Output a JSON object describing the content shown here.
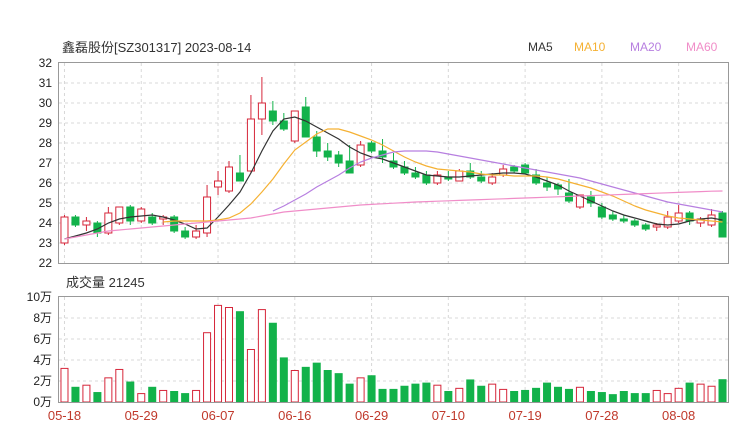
{
  "header": {
    "title": "鑫磊股份[SZ301317] 2023-08-14",
    "volume_title": "成交量 21245"
  },
  "colors": {
    "up": "#d6263a",
    "down": "#12b24a",
    "ma5": "#333333",
    "ma10": "#f5b133",
    "ma20": "#b77fe0",
    "ma60": "#f08dc8"
  },
  "chart_data": [
    {
      "type": "candlestick",
      "title": "鑫磊股份[SZ301317] 2023-08-14",
      "ylim": [
        22,
        32
      ],
      "yticks": [
        "22",
        "23",
        "24",
        "25",
        "26",
        "27",
        "28",
        "29",
        "30",
        "31",
        "32"
      ],
      "grid": true,
      "legend": [
        "MA5",
        "MA10",
        "MA20",
        "MA60"
      ],
      "legend_position": "top-right",
      "dates": [
        "05-18",
        "05-19",
        "05-22",
        "05-23",
        "05-24",
        "05-25",
        "05-26",
        "05-29",
        "05-30",
        "05-31",
        "06-01",
        "06-02",
        "06-05",
        "06-06",
        "06-07",
        "06-08",
        "06-09",
        "06-12",
        "06-13",
        "06-14",
        "06-15",
        "06-16",
        "06-19",
        "06-20",
        "06-21",
        "06-26",
        "06-27",
        "06-28",
        "06-29",
        "06-30",
        "07-03",
        "07-04",
        "07-05",
        "07-06",
        "07-07",
        "07-10",
        "07-11",
        "07-12",
        "07-13",
        "07-14",
        "07-17",
        "07-18",
        "07-19",
        "07-20",
        "07-21",
        "07-24",
        "07-25",
        "07-26",
        "07-27",
        "07-28",
        "07-31",
        "08-01",
        "08-02",
        "08-03",
        "08-04",
        "08-07",
        "08-08",
        "08-09",
        "08-10",
        "08-11",
        "08-14"
      ],
      "x_ticks": [
        "05-18",
        "05-29",
        "06-07",
        "06-16",
        "06-29",
        "07-10",
        "07-19",
        "07-28",
        "08-08"
      ],
      "ohlc": [
        [
          23.0,
          24.4,
          22.9,
          24.3
        ],
        [
          24.3,
          24.4,
          23.8,
          23.9
        ],
        [
          23.9,
          24.3,
          23.6,
          24.1
        ],
        [
          24.0,
          24.1,
          23.3,
          23.5
        ],
        [
          23.5,
          24.8,
          23.4,
          24.5
        ],
        [
          24.0,
          24.8,
          23.9,
          24.8
        ],
        [
          24.8,
          24.9,
          23.9,
          24.1
        ],
        [
          24.1,
          24.8,
          24.0,
          24.7
        ],
        [
          24.3,
          24.5,
          23.9,
          24.0
        ],
        [
          24.2,
          24.4,
          23.9,
          24.3
        ],
        [
          24.3,
          24.4,
          23.5,
          23.6
        ],
        [
          23.6,
          23.8,
          23.2,
          23.3
        ],
        [
          23.3,
          23.9,
          23.2,
          23.6
        ],
        [
          23.5,
          25.9,
          23.3,
          25.3
        ],
        [
          25.8,
          26.6,
          25.4,
          26.1
        ],
        [
          25.6,
          27.1,
          25.5,
          26.8
        ],
        [
          26.5,
          27.4,
          26.2,
          26.1
        ],
        [
          26.6,
          30.4,
          26.5,
          29.2
        ],
        [
          29.2,
          31.3,
          28.4,
          30.0
        ],
        [
          29.6,
          30.1,
          28.9,
          29.1
        ],
        [
          29.1,
          29.5,
          28.6,
          28.7
        ],
        [
          28.1,
          29.6,
          28.0,
          29.6
        ],
        [
          29.8,
          30.3,
          28.3,
          28.3
        ],
        [
          28.3,
          28.6,
          27.3,
          27.6
        ],
        [
          27.6,
          28.0,
          27.1,
          27.3
        ],
        [
          27.4,
          27.6,
          26.8,
          27.0
        ],
        [
          27.1,
          27.9,
          26.5,
          26.5
        ],
        [
          26.9,
          28.1,
          26.8,
          27.9
        ],
        [
          28.0,
          28.1,
          27.5,
          27.6
        ],
        [
          27.6,
          28.2,
          27.0,
          27.3
        ],
        [
          27.1,
          27.5,
          26.7,
          26.8
        ],
        [
          26.8,
          27.1,
          26.4,
          26.5
        ],
        [
          26.5,
          26.8,
          26.2,
          26.3
        ],
        [
          26.4,
          26.6,
          25.9,
          26.0
        ],
        [
          26.0,
          26.6,
          25.9,
          26.4
        ],
        [
          26.3,
          26.6,
          26.1,
          26.2
        ],
        [
          26.1,
          26.7,
          26.1,
          26.6
        ],
        [
          26.6,
          27.0,
          26.2,
          26.3
        ],
        [
          26.3,
          26.6,
          26.0,
          26.1
        ],
        [
          26.0,
          26.5,
          25.9,
          26.3
        ],
        [
          26.4,
          26.9,
          26.3,
          26.7
        ],
        [
          26.8,
          26.9,
          26.5,
          26.6
        ],
        [
          26.9,
          27.0,
          26.5,
          26.5
        ],
        [
          26.4,
          26.7,
          25.9,
          26.0
        ],
        [
          26.0,
          26.3,
          25.6,
          25.8
        ],
        [
          25.9,
          26.0,
          25.4,
          25.7
        ],
        [
          25.5,
          26.2,
          25.0,
          25.1
        ],
        [
          24.8,
          25.4,
          24.7,
          25.4
        ],
        [
          25.3,
          25.6,
          24.8,
          25.0
        ],
        [
          24.8,
          25.0,
          24.2,
          24.3
        ],
        [
          24.4,
          24.6,
          24.1,
          24.2
        ],
        [
          24.2,
          24.4,
          24.0,
          24.1
        ],
        [
          24.1,
          24.2,
          23.8,
          23.9
        ],
        [
          23.9,
          24.0,
          23.6,
          23.7
        ],
        [
          23.8,
          24.0,
          23.6,
          23.9
        ],
        [
          23.8,
          24.6,
          23.7,
          24.3
        ],
        [
          24.1,
          24.9,
          24.0,
          24.5
        ],
        [
          24.5,
          24.6,
          23.9,
          24.1
        ],
        [
          24.0,
          24.3,
          23.8,
          24.2
        ],
        [
          23.9,
          24.7,
          23.8,
          24.4
        ],
        [
          24.5,
          24.6,
          23.3,
          23.3
        ]
      ],
      "ma5": [
        23.2,
        23.35,
        23.5,
        23.7,
        24.0,
        24.2,
        24.3,
        24.35,
        24.4,
        24.3,
        24.15,
        23.95,
        23.7,
        23.75,
        24.3,
        24.9,
        25.55,
        26.5,
        27.6,
        28.6,
        29.2,
        29.3,
        29.1,
        28.8,
        28.5,
        28.2,
        27.8,
        27.5,
        27.3,
        27.2,
        27.0,
        26.8,
        26.6,
        26.4,
        26.35,
        26.3,
        26.3,
        26.35,
        26.4,
        26.45,
        26.5,
        26.5,
        26.45,
        26.3,
        26.1,
        25.9,
        25.6,
        25.35,
        25.1,
        24.85,
        24.6,
        24.4,
        24.25,
        24.1,
        23.95,
        23.9,
        23.95,
        24.1,
        24.2,
        24.25,
        24.15
      ],
      "ma10": [
        null,
        null,
        null,
        null,
        null,
        null,
        null,
        null,
        null,
        24.05,
        24.1,
        24.1,
        24.1,
        24.1,
        24.15,
        24.25,
        24.5,
        24.95,
        25.55,
        26.2,
        26.95,
        27.65,
        28.05,
        28.45,
        28.7,
        28.7,
        28.55,
        28.35,
        28.15,
        27.9,
        27.6,
        27.3,
        27.05,
        26.85,
        26.7,
        26.65,
        26.6,
        26.55,
        26.45,
        26.4,
        26.4,
        26.35,
        26.35,
        26.35,
        26.3,
        26.2,
        26.05,
        25.9,
        25.75,
        25.55,
        25.35,
        25.1,
        24.85,
        24.65,
        24.5,
        24.35,
        24.25,
        24.2,
        24.15,
        24.1,
        24.05
      ],
      "ma20": [
        null,
        null,
        null,
        null,
        null,
        null,
        null,
        null,
        null,
        null,
        null,
        null,
        null,
        null,
        null,
        null,
        null,
        null,
        null,
        24.6,
        24.85,
        25.15,
        25.45,
        25.8,
        26.1,
        26.4,
        26.75,
        27.05,
        27.25,
        27.4,
        27.55,
        27.6,
        27.6,
        27.6,
        27.55,
        27.45,
        27.35,
        27.25,
        27.15,
        27.05,
        26.95,
        26.85,
        26.75,
        26.65,
        26.55,
        26.45,
        26.35,
        26.25,
        26.1,
        25.95,
        25.8,
        25.65,
        25.5,
        25.35,
        25.2,
        25.05,
        24.95,
        24.85,
        24.75,
        24.65,
        24.55
      ],
      "ma60": [
        23.2,
        23.3,
        23.4,
        23.5,
        23.6,
        23.65,
        23.7,
        23.75,
        23.8,
        23.85,
        23.9,
        23.95,
        24.0,
        24.05,
        24.1,
        24.15,
        24.2,
        24.25,
        24.35,
        24.45,
        24.55,
        24.6,
        24.65,
        24.7,
        24.75,
        24.8,
        24.85,
        24.9,
        24.93,
        24.96,
        24.99,
        25.02,
        25.05,
        25.07,
        25.09,
        25.11,
        25.13,
        25.15,
        25.17,
        25.19,
        25.21,
        25.23,
        25.25,
        25.27,
        25.29,
        25.31,
        25.33,
        25.35,
        25.37,
        25.39,
        25.41,
        25.43,
        25.45,
        25.47,
        25.49,
        25.51,
        25.53,
        25.55,
        25.57,
        25.59,
        25.6
      ]
    },
    {
      "type": "bar",
      "title": "成交量 21245",
      "ylim": [
        0,
        100000
      ],
      "yticks": [
        "0万",
        "2万",
        "4万",
        "6万",
        "8万",
        "10万"
      ],
      "grid": true,
      "volume": [
        32000,
        14000,
        16000,
        9000,
        23000,
        31000,
        19000,
        8000,
        14000,
        11000,
        10000,
        8000,
        11000,
        66000,
        92000,
        90000,
        86000,
        50000,
        88000,
        75000,
        42000,
        30000,
        33000,
        37000,
        30000,
        27000,
        17000,
        23000,
        25000,
        12000,
        12000,
        15000,
        17000,
        18000,
        16000,
        10000,
        13000,
        21000,
        15000,
        17000,
        12000,
        10000,
        11000,
        13000,
        18000,
        14000,
        12000,
        14000,
        10000,
        9000,
        7000,
        10000,
        8000,
        8000,
        11000,
        8000,
        13000,
        18000,
        17000,
        15000,
        21245
      ]
    }
  ]
}
